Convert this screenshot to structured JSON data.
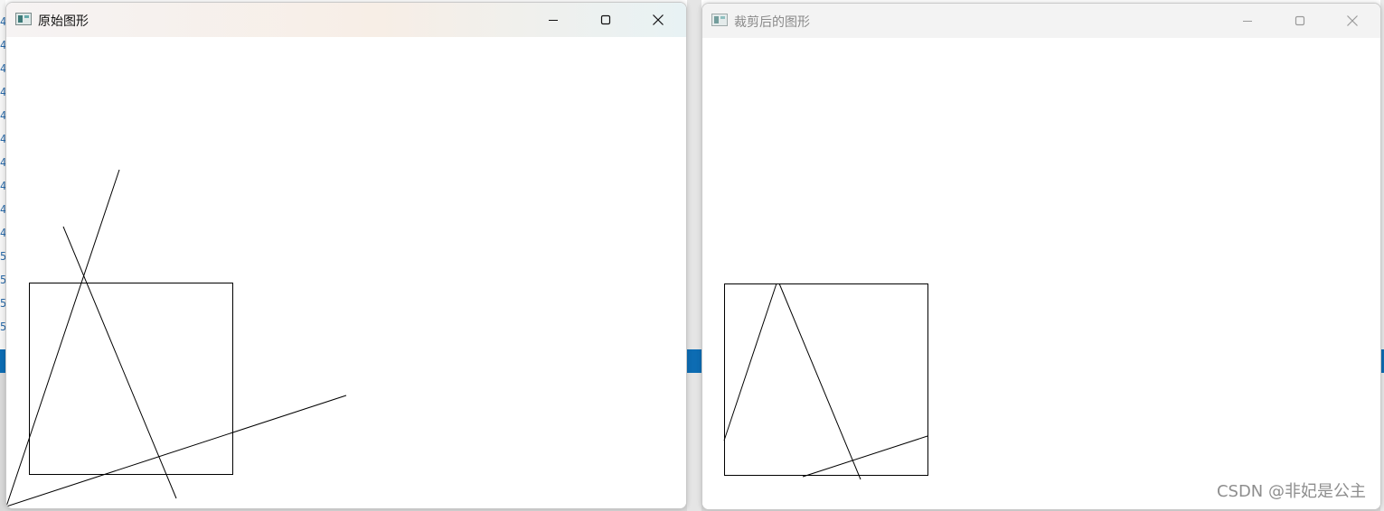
{
  "windows": {
    "original": {
      "title": "原始图形",
      "icon": "app-window-icon",
      "controls": [
        "minimize-icon",
        "maximize-icon",
        "close-icon"
      ]
    },
    "clipped": {
      "title": "裁剪后的图形",
      "icon": "app-window-icon",
      "controls": [
        "minimize-icon",
        "maximize-icon",
        "close-icon"
      ]
    }
  },
  "watermark": "CSDN @非妃是公主",
  "colors": {
    "drawing_stroke": "#000000",
    "accent_blue": "#0d6cb3"
  }
}
